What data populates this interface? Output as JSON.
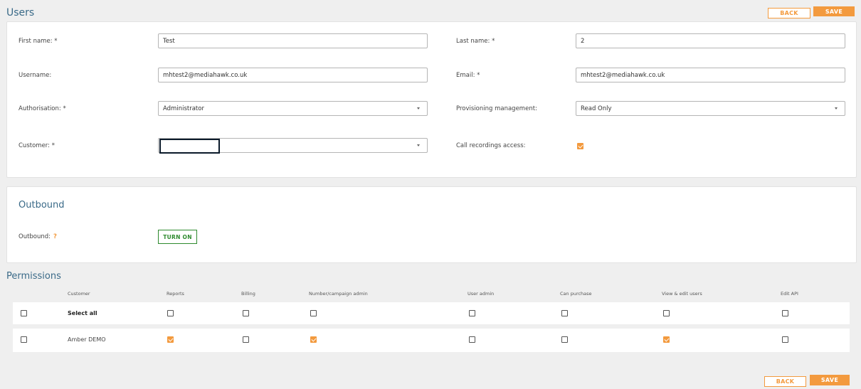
{
  "users": {
    "title": "Users",
    "back_label": "BACK",
    "save_label": "SAVE",
    "fields": {
      "first_name": {
        "label": "First name: *",
        "value": "Test"
      },
      "last_name": {
        "label": "Last name: *",
        "value": "2"
      },
      "username": {
        "label": "Username:",
        "value": "mhtest2@mediahawk.co.uk"
      },
      "email": {
        "label": "Email: *",
        "value": "mhtest2@mediahawk.co.uk"
      },
      "authorisation": {
        "label": "Authorisation: *",
        "value": "Administrator"
      },
      "provisioning": {
        "label": "Provisioning management:",
        "value": "Read Only"
      },
      "customer": {
        "label": "Customer: *",
        "value": ""
      },
      "call_recordings": {
        "label": "Call recordings access:",
        "checked": true
      }
    }
  },
  "outbound": {
    "title": "Outbound",
    "label": "Outbound:",
    "help": "?",
    "button_label": "TURN ON"
  },
  "permissions": {
    "title": "Permissions",
    "columns": [
      "Customer",
      "Reports",
      "Billing",
      "Number/campaign admin",
      "User admin",
      "Can purchase",
      "View & edit users",
      "Edit API"
    ],
    "rows": [
      {
        "label": "Select all",
        "bold": true,
        "row_checked": false,
        "checks": [
          false,
          false,
          false,
          false,
          false,
          false,
          false
        ]
      },
      {
        "label": "Amber DEMO",
        "bold": false,
        "row_checked": false,
        "checks": [
          true,
          false,
          true,
          false,
          false,
          true,
          false
        ]
      }
    ]
  },
  "footer": {
    "back_label": "BACK",
    "save_label": "SAVE"
  },
  "colors": {
    "accent": "#f39a3e",
    "heading": "#3a6a88",
    "success": "#2e8a2e"
  }
}
